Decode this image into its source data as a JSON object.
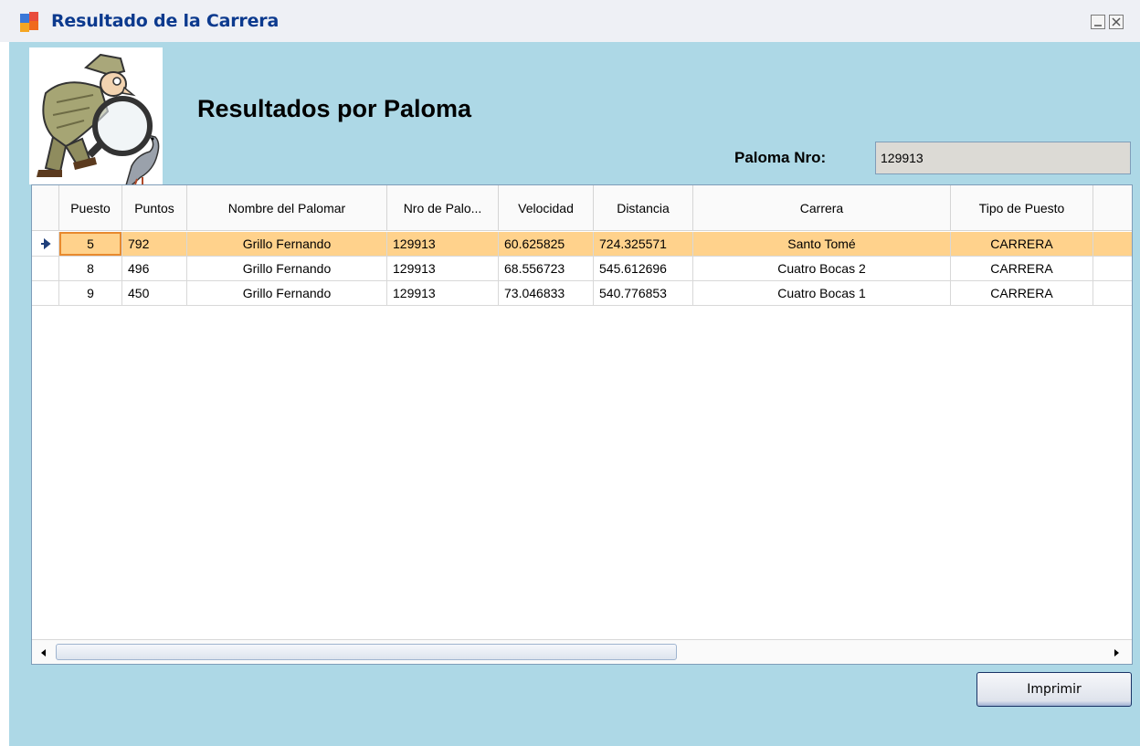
{
  "window": {
    "title": "Resultado de la Carrera"
  },
  "heading": "Resultados por Paloma",
  "paloma": {
    "label": "Paloma Nro:",
    "value": "129913"
  },
  "grid": {
    "columns": [
      "Puesto",
      "Puntos",
      "Nombre del Palomar",
      "Nro de Palo...",
      "Velocidad",
      "Distancia",
      "Carrera",
      "Tipo de Puesto"
    ],
    "rows": [
      [
        "5",
        "792",
        "Grillo Fernando",
        "129913",
        "60.625825",
        "724.325571",
        "Santo Tomé",
        "CARRERA"
      ],
      [
        "8",
        "496",
        "Grillo Fernando",
        "129913",
        "68.556723",
        "545.612696",
        "Cuatro Bocas 2",
        "CARRERA"
      ],
      [
        "9",
        "450",
        "Grillo Fernando",
        "129913",
        "73.046833",
        "540.776853",
        "Cuatro Bocas 1",
        "CARRERA"
      ]
    ],
    "selected_row": 0
  },
  "buttons": {
    "print_label": "Imprimir"
  },
  "colors": {
    "form_background": "#add8e6",
    "selected_row": "#ffd28c",
    "title_text": "#0c3a8e"
  }
}
